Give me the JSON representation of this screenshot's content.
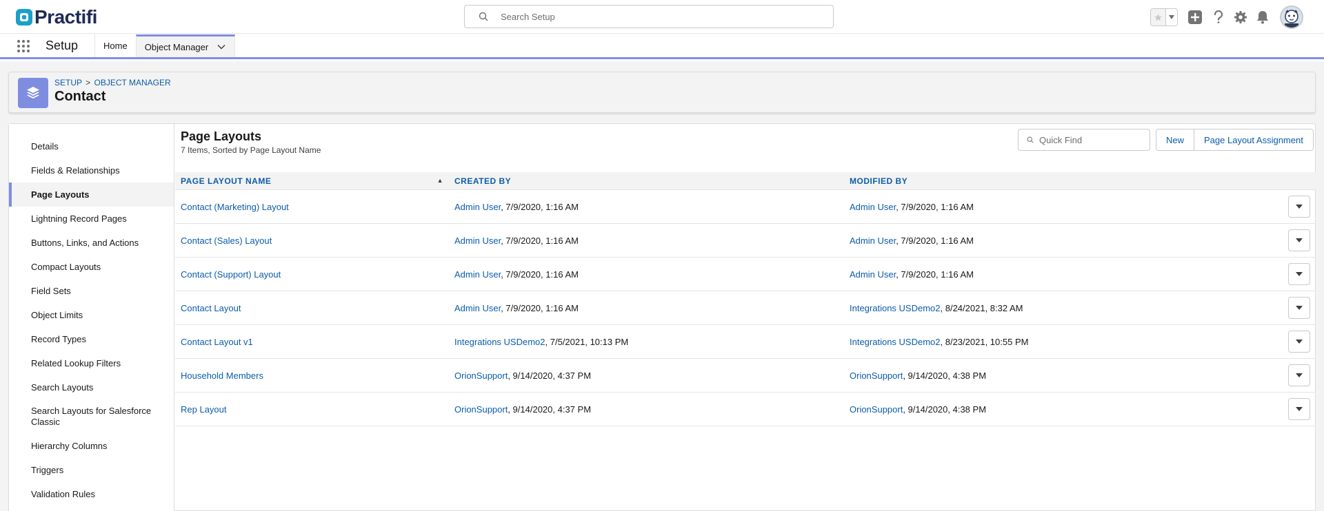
{
  "brand": {
    "name": "Practifi",
    "mark_color": "#1aa0c8",
    "text_color": "#1f2a56"
  },
  "global_search": {
    "placeholder": "Search Setup"
  },
  "header_icons": [
    "favorite-star-icon",
    "favorites-dropdown-icon",
    "global-actions-add-icon",
    "help-icon",
    "setup-gear-icon",
    "notifications-bell-icon",
    "user-avatar"
  ],
  "app_nav": {
    "app_name": "Setup",
    "tabs": [
      {
        "label": "Home"
      },
      {
        "label": "Object Manager"
      }
    ]
  },
  "object_header": {
    "breadcrumb": [
      "SETUP",
      "OBJECT MANAGER"
    ],
    "breadcrumb_separator": ">",
    "title": "Contact",
    "icon": "layers-icon",
    "icon_color": "#7f8de1"
  },
  "sidenav": {
    "items": [
      {
        "label": "Details"
      },
      {
        "label": "Fields & Relationships"
      },
      {
        "label": "Page Layouts"
      },
      {
        "label": "Lightning Record Pages"
      },
      {
        "label": "Buttons, Links, and Actions"
      },
      {
        "label": "Compact Layouts"
      },
      {
        "label": "Field Sets"
      },
      {
        "label": "Object Limits"
      },
      {
        "label": "Record Types"
      },
      {
        "label": "Related Lookup Filters"
      },
      {
        "label": "Search Layouts"
      },
      {
        "label": "Search Layouts for Salesforce Classic"
      },
      {
        "label": "Hierarchy Columns"
      },
      {
        "label": "Triggers"
      },
      {
        "label": "Validation Rules"
      }
    ],
    "active_label": "Page Layouts"
  },
  "main": {
    "title": "Page Layouts",
    "subtitle": "7 Items, Sorted by Page Layout Name",
    "quick_find_placeholder": "Quick Find",
    "buttons": {
      "new": "New",
      "assignment": "Page Layout Assignment"
    },
    "columns": [
      "PAGE LAYOUT NAME",
      "CREATED BY",
      "MODIFIED BY"
    ],
    "rows": [
      {
        "name": "Contact (Marketing) Layout",
        "created_user": "Admin User",
        "created_date": ", 7/9/2020, 1:16 AM",
        "modified_user": "Admin User",
        "modified_date": ", 7/9/2020, 1:16 AM"
      },
      {
        "name": "Contact (Sales) Layout",
        "created_user": "Admin User",
        "created_date": ", 7/9/2020, 1:16 AM",
        "modified_user": "Admin User",
        "modified_date": ", 7/9/2020, 1:16 AM"
      },
      {
        "name": "Contact (Support) Layout",
        "created_user": "Admin User",
        "created_date": ", 7/9/2020, 1:16 AM",
        "modified_user": "Admin User",
        "modified_date": ", 7/9/2020, 1:16 AM"
      },
      {
        "name": "Contact Layout",
        "created_user": "Admin User",
        "created_date": ", 7/9/2020, 1:16 AM",
        "modified_user": "Integrations USDemo2",
        "modified_date": ", 8/24/2021, 8:32 AM"
      },
      {
        "name": "Contact Layout v1",
        "created_user": "Integrations USDemo2",
        "created_date": ", 7/5/2021, 10:13 PM",
        "modified_user": "Integrations USDemo2",
        "modified_date": ", 8/23/2021, 10:55 PM"
      },
      {
        "name": "Household Members",
        "created_user": "OrionSupport",
        "created_date": ", 9/14/2020, 4:37 PM",
        "modified_user": "OrionSupport",
        "modified_date": ", 9/14/2020, 4:38 PM"
      },
      {
        "name": "Rep Layout",
        "created_user": "OrionSupport",
        "created_date": ", 9/14/2020, 4:37 PM",
        "modified_user": "OrionSupport",
        "modified_date": ", 9/14/2020, 4:38 PM"
      }
    ]
  },
  "colors": {
    "link": "#0b5cab",
    "accent": "#7f8de1",
    "page_bg": "#f3f3f3"
  }
}
